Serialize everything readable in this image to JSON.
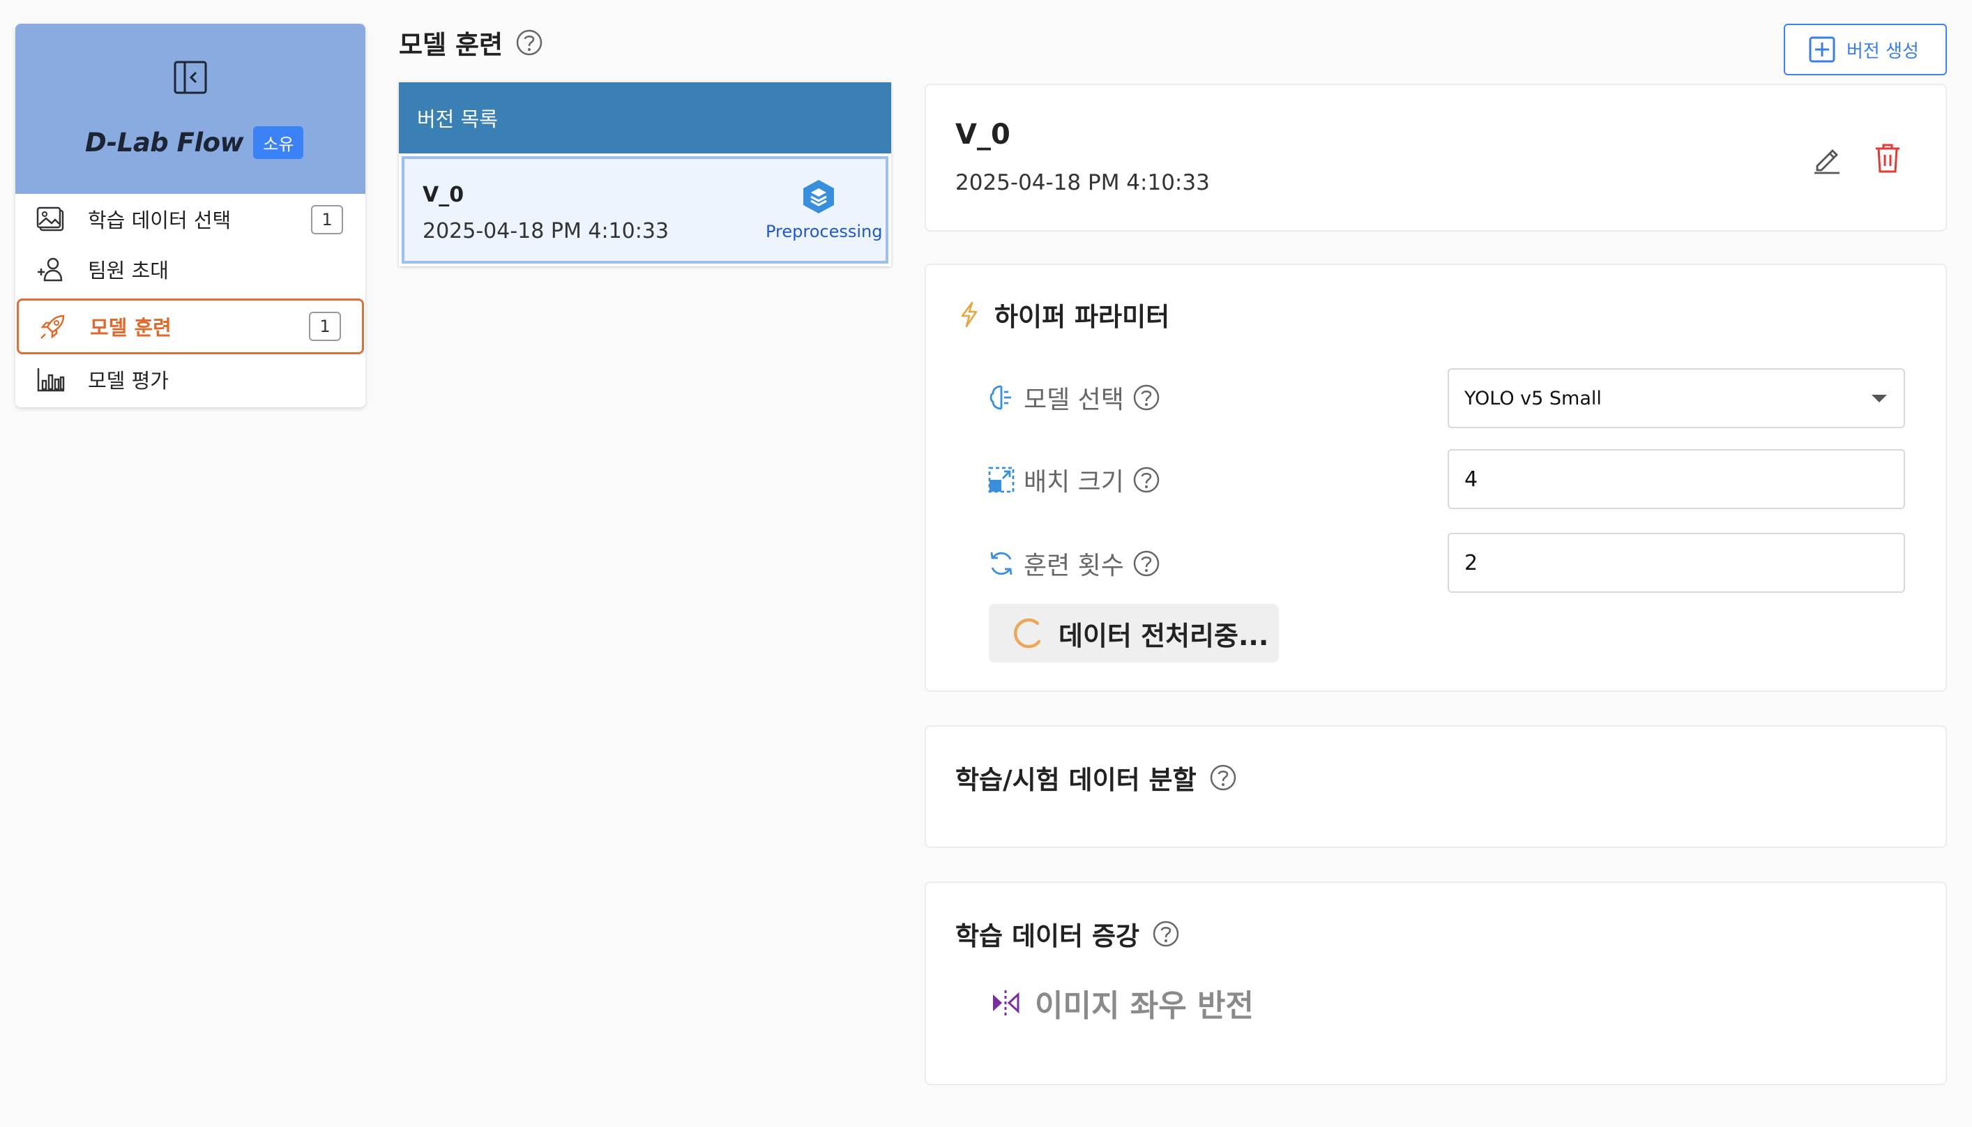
{
  "sidebar": {
    "brand": "D-Lab Flow",
    "brand_badge": "소유",
    "items": [
      {
        "label": "학습 데이터 선택",
        "count": "1",
        "icon": "image-icon"
      },
      {
        "label": "팀원 초대",
        "icon": "add-user-icon"
      },
      {
        "label": "모델 훈련",
        "count": "1",
        "icon": "rocket-icon",
        "active": true
      },
      {
        "label": "모델 평가",
        "icon": "bar-chart-icon"
      }
    ]
  },
  "page": {
    "title": "모델 훈련"
  },
  "version_list": {
    "header": "버전 목록",
    "items": [
      {
        "name": "V_0",
        "date": "2025-04-18 PM 4:10:33",
        "status": "Preprocessing"
      }
    ]
  },
  "create_button": {
    "label": "버전 생성"
  },
  "version_detail": {
    "name": "V_0",
    "date": "2025-04-18 PM 4:10:33"
  },
  "hyperparams": {
    "title": "하이퍼 파라미터",
    "model_label": "모델 선택",
    "model_value": "YOLO v5 Small",
    "batch_label": "배치 크기",
    "batch_value": "4",
    "epochs_label": "훈련 횟수",
    "epochs_value": "2",
    "preprocessing_label": "데이터 전처리중..."
  },
  "split": {
    "title": "학습/시험 데이터 분할"
  },
  "augmentation": {
    "title": "학습 데이터 증강",
    "items": [
      {
        "label": "이미지 좌우 반전"
      }
    ]
  },
  "colors": {
    "accent": "#3b82f6",
    "sidebar_header": "#8aabe0",
    "active_orange": "#e06a2c",
    "list_header": "#3a80b4",
    "delete_red": "#e53935"
  }
}
